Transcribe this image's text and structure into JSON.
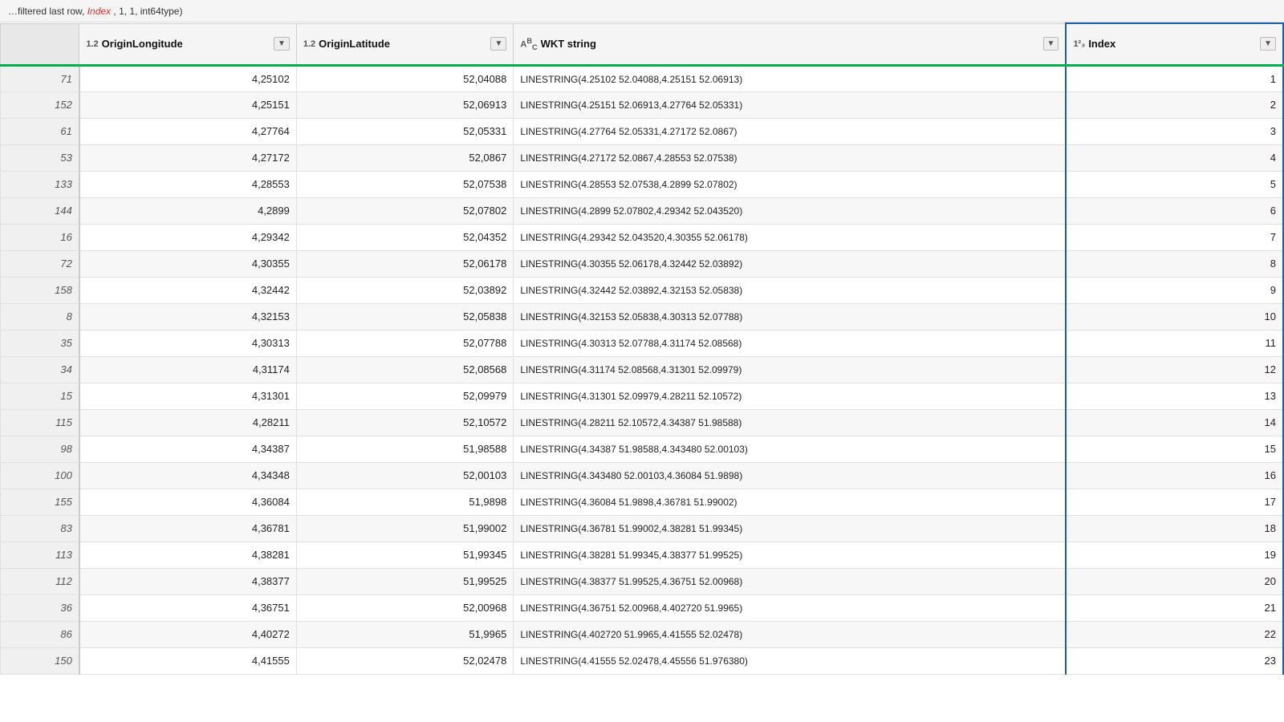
{
  "topbar": {
    "text": "filtered last row, ",
    "index_label": "Index",
    "suffix": " , 1, 1, int64type)"
  },
  "columns": {
    "rownum": {
      "label": ""
    },
    "orig_lon": {
      "type_badge": "1.2",
      "name": "OriginLongitude"
    },
    "orig_lat": {
      "type_badge": "1.2",
      "name": "OriginLatitude"
    },
    "wkt": {
      "type_badge": "Aᵇᴄ C",
      "name": "WKT string"
    },
    "index": {
      "type_badge": "1²₃",
      "name": "Index"
    }
  },
  "rows": [
    {
      "rownum": "71",
      "lon": "4,25102",
      "lat": "52,04088",
      "wkt": "LINESTRING(4.25102 52.04088,4.25151 52.06913)",
      "index": "1"
    },
    {
      "rownum": "152",
      "lon": "4,25151",
      "lat": "52,06913",
      "wkt": "LINESTRING(4.25151 52.06913,4.27764 52.05331)",
      "index": "2"
    },
    {
      "rownum": "61",
      "lon": "4,27764",
      "lat": "52,05331",
      "wkt": "LINESTRING(4.27764 52.05331,4.27172 52.0867)",
      "index": "3"
    },
    {
      "rownum": "53",
      "lon": "4,27172",
      "lat": "52,0867",
      "wkt": "LINESTRING(4.27172 52.0867,4.28553 52.07538)",
      "index": "4"
    },
    {
      "rownum": "133",
      "lon": "4,28553",
      "lat": "52,07538",
      "wkt": "LINESTRING(4.28553 52.07538,4.2899 52.07802)",
      "index": "5"
    },
    {
      "rownum": "144",
      "lon": "4,2899",
      "lat": "52,07802",
      "wkt": "LINESTRING(4.2899 52.07802,4.29342 52.043520)",
      "index": "6"
    },
    {
      "rownum": "16",
      "lon": "4,29342",
      "lat": "52,04352",
      "wkt": "LINESTRING(4.29342 52.043520,4.30355 52.06178)",
      "index": "7"
    },
    {
      "rownum": "72",
      "lon": "4,30355",
      "lat": "52,06178",
      "wkt": "LINESTRING(4.30355 52.06178,4.32442 52.03892)",
      "index": "8"
    },
    {
      "rownum": "158",
      "lon": "4,32442",
      "lat": "52,03892",
      "wkt": "LINESTRING(4.32442 52.03892,4.32153 52.05838)",
      "index": "9"
    },
    {
      "rownum": "8",
      "lon": "4,32153",
      "lat": "52,05838",
      "wkt": "LINESTRING(4.32153 52.05838,4.30313 52.07788)",
      "index": "10"
    },
    {
      "rownum": "35",
      "lon": "4,30313",
      "lat": "52,07788",
      "wkt": "LINESTRING(4.30313 52.07788,4.31174 52.08568)",
      "index": "11"
    },
    {
      "rownum": "34",
      "lon": "4,31174",
      "lat": "52,08568",
      "wkt": "LINESTRING(4.31174 52.08568,4.31301 52.09979)",
      "index": "12"
    },
    {
      "rownum": "15",
      "lon": "4,31301",
      "lat": "52,09979",
      "wkt": "LINESTRING(4.31301 52.09979,4.28211 52.10572)",
      "index": "13"
    },
    {
      "rownum": "115",
      "lon": "4,28211",
      "lat": "52,10572",
      "wkt": "LINESTRING(4.28211 52.10572,4.34387 51.98588)",
      "index": "14"
    },
    {
      "rownum": "98",
      "lon": "4,34387",
      "lat": "51,98588",
      "wkt": "LINESTRING(4.34387 51.98588,4.343480 52.00103)",
      "index": "15"
    },
    {
      "rownum": "100",
      "lon": "4,34348",
      "lat": "52,00103",
      "wkt": "LINESTRING(4.343480 52.00103,4.36084 51.9898)",
      "index": "16"
    },
    {
      "rownum": "155",
      "lon": "4,36084",
      "lat": "51,9898",
      "wkt": "LINESTRING(4.36084 51.9898,4.36781 51.99002)",
      "index": "17"
    },
    {
      "rownum": "83",
      "lon": "4,36781",
      "lat": "51,99002",
      "wkt": "LINESTRING(4.36781 51.99002,4.38281 51.99345)",
      "index": "18"
    },
    {
      "rownum": "113",
      "lon": "4,38281",
      "lat": "51,99345",
      "wkt": "LINESTRING(4.38281 51.99345,4.38377 51.99525)",
      "index": "19"
    },
    {
      "rownum": "112",
      "lon": "4,38377",
      "lat": "51,99525",
      "wkt": "LINESTRING(4.38377 51.99525,4.36751 52.00968)",
      "index": "20"
    },
    {
      "rownum": "36",
      "lon": "4,36751",
      "lat": "52,00968",
      "wkt": "LINESTRING(4.36751 52.00968,4.402720 51.9965)",
      "index": "21"
    },
    {
      "rownum": "86",
      "lon": "4,40272",
      "lat": "51,9965",
      "wkt": "LINESTRING(4.402720 51.9965,4.41555 52.02478)",
      "index": "22"
    },
    {
      "rownum": "150",
      "lon": "4,41555",
      "lat": "52,02478",
      "wkt": "LINESTRING(4.41555 52.02478,4.45556 51.976380)",
      "index": "23"
    }
  ],
  "dropdown_arrow": "▼",
  "colors": {
    "active_border": "#1a5fa8",
    "header_green_border": "#00b050",
    "accent_red": "#e03030"
  }
}
